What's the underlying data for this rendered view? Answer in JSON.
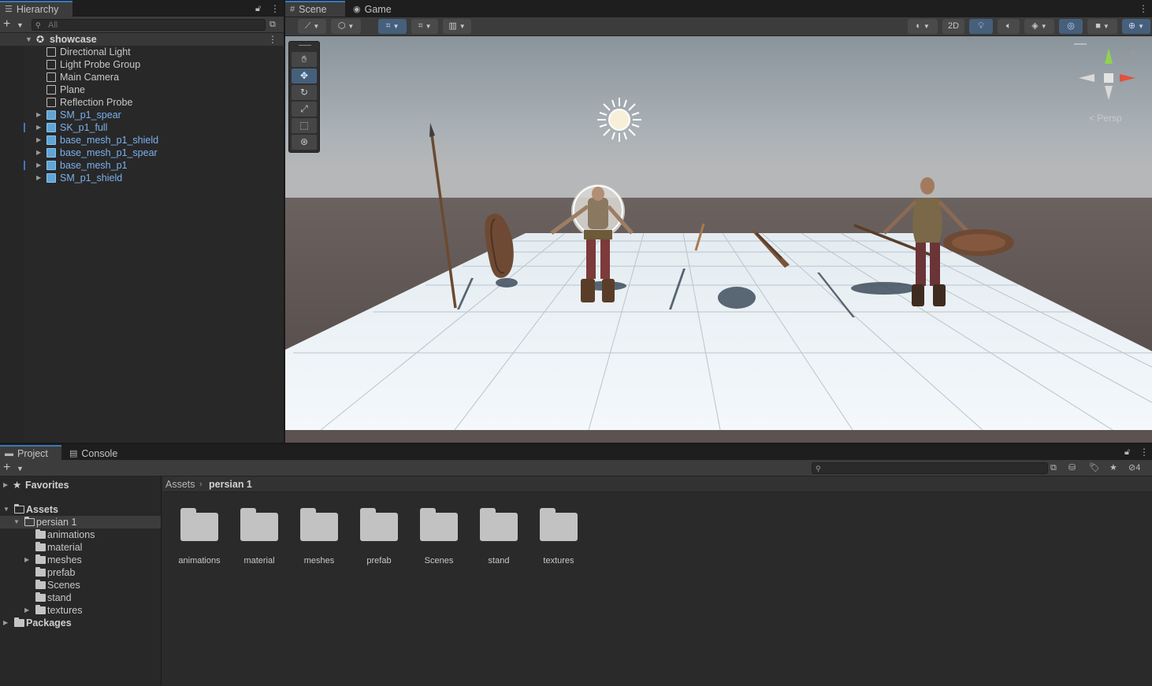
{
  "hierarchy": {
    "tab_label": "Hierarchy",
    "search_placeholder": "All",
    "scene_name": "showcase",
    "items": [
      {
        "label": "Directional Light",
        "prefab": false,
        "expandable": false,
        "marked": false
      },
      {
        "label": "Light Probe Group",
        "prefab": false,
        "expandable": false,
        "marked": false
      },
      {
        "label": "Main Camera",
        "prefab": false,
        "expandable": false,
        "marked": false
      },
      {
        "label": "Plane",
        "prefab": false,
        "expandable": false,
        "marked": false
      },
      {
        "label": "Reflection Probe",
        "prefab": false,
        "expandable": false,
        "marked": false
      },
      {
        "label": "SM_p1_spear",
        "prefab": true,
        "expandable": true,
        "marked": false
      },
      {
        "label": "SK_p1_full",
        "prefab": true,
        "expandable": true,
        "marked": true
      },
      {
        "label": "base_mesh_p1_shield",
        "prefab": true,
        "expandable": true,
        "marked": false
      },
      {
        "label": "base_mesh_p1_spear",
        "prefab": true,
        "expandable": true,
        "marked": false
      },
      {
        "label": "base_mesh_p1",
        "prefab": true,
        "expandable": true,
        "marked": true
      },
      {
        "label": "SM_p1_shield",
        "prefab": true,
        "expandable": true,
        "marked": false
      }
    ]
  },
  "scene_view": {
    "tabs": [
      {
        "label": "Scene",
        "icon": "grid-icon"
      },
      {
        "label": "Game",
        "icon": "gamepad-icon"
      }
    ],
    "toggle_2d_label": "2D",
    "persp_label": "Persp",
    "accent_color": "#3a79bb"
  },
  "project": {
    "tabs": [
      {
        "label": "Project",
        "icon": "folder-icon"
      },
      {
        "label": "Console",
        "icon": "console-icon"
      }
    ],
    "hidden_count": "4",
    "tree": {
      "favorites": "Favorites",
      "assets": "Assets",
      "persian": "persian 1",
      "children": [
        "animations",
        "material",
        "meshes",
        "prefab",
        "Scenes",
        "stand",
        "textures"
      ],
      "packages": "Packages"
    },
    "breadcrumb": {
      "root": "Assets",
      "current": "persian 1"
    },
    "folders": [
      "animations",
      "material",
      "meshes",
      "prefab",
      "Scenes",
      "stand",
      "textures"
    ]
  }
}
